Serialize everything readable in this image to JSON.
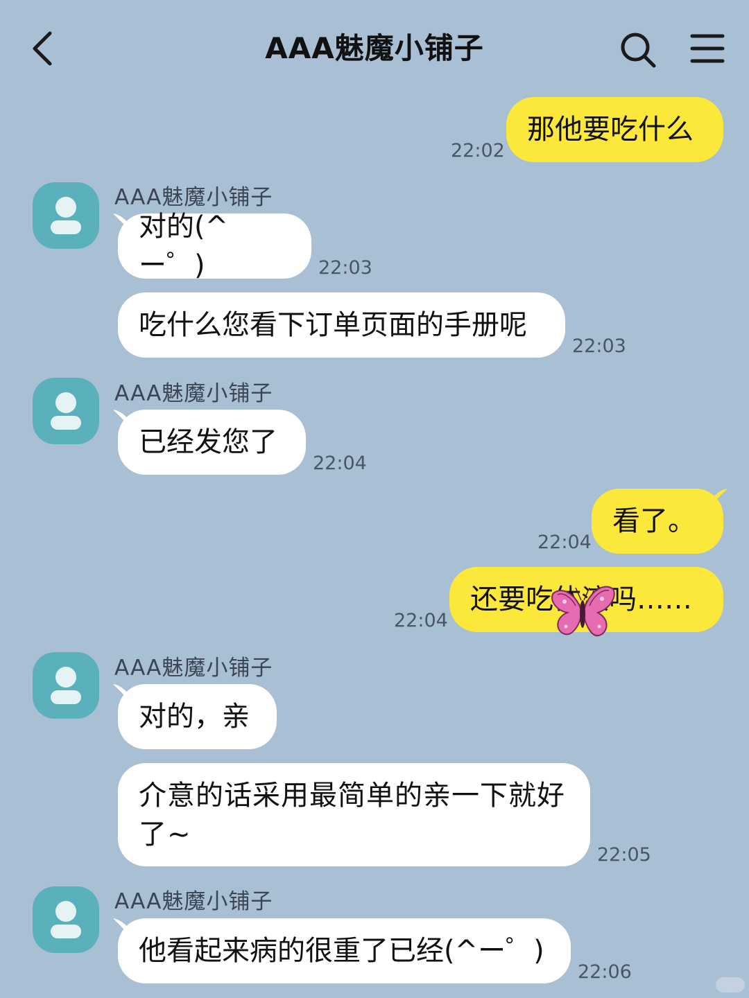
{
  "header": {
    "title": "AAA魅魔小铺子",
    "back_icon": "chevron-left-icon",
    "search_icon": "search-icon",
    "menu_icon": "hamburger-menu-icon"
  },
  "colors": {
    "background": "#a9bfd4",
    "outgoing_bubble": "#fce83a",
    "incoming_bubble": "#ffffff",
    "avatar": "#5ab1bb"
  },
  "messages": [
    {
      "direction": "out",
      "text": "那他要吃什么",
      "time": "22:02"
    },
    {
      "direction": "in",
      "sender": "AAA魅魔小铺子",
      "text": "对的(^ー゜)",
      "time": "22:03"
    },
    {
      "direction": "in",
      "text": "吃什么您看下订单页面的手册呢",
      "time": "22:03"
    },
    {
      "direction": "in",
      "sender": "AAA魅魔小铺子",
      "text": "已经发您了",
      "time": "22:04"
    },
    {
      "direction": "out",
      "text": "看了。",
      "time": "22:04"
    },
    {
      "direction": "out",
      "text": "还要吃体液吗……",
      "time": "22:04"
    },
    {
      "direction": "in",
      "sender": "AAA魅魔小铺子",
      "text": "对的，亲"
    },
    {
      "direction": "in",
      "text": "介意的话采用最简单的亲一下就好了~",
      "time": "22:05"
    },
    {
      "direction": "in",
      "sender": "AAA魅魔小铺子",
      "text": "他看起来病的很重了已经(^ー゜)",
      "time": "22:06"
    }
  ]
}
